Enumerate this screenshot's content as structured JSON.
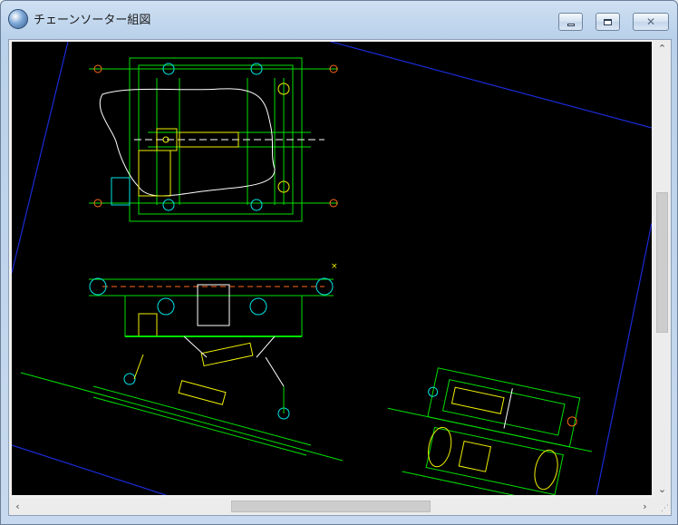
{
  "window": {
    "title": "チェーンソーター組図",
    "app_icon": "cad-viewer-icon",
    "controls": {
      "minimize_icon": "minimize-icon",
      "maximize_icon": "maximize-icon",
      "close_icon": "close-icon"
    }
  },
  "drawing": {
    "background_color": "#000000",
    "colors": {
      "frame_border": "#1a2bd6",
      "structure": "#00e000",
      "parts_cyan": "#00e5e5",
      "parts_yellow": "#f0f000",
      "parts_white": "#ffffff",
      "accent_orange": "#ff6a1a"
    },
    "views": [
      "top-view",
      "front-view",
      "side-view-left",
      "side-view-right"
    ]
  },
  "scrollbars": {
    "vertical": {
      "up_icon": "arrow-up-icon",
      "down_icon": "arrow-down-icon"
    },
    "horizontal": {
      "left_icon": "arrow-left-icon",
      "right_icon": "arrow-right-icon"
    }
  }
}
